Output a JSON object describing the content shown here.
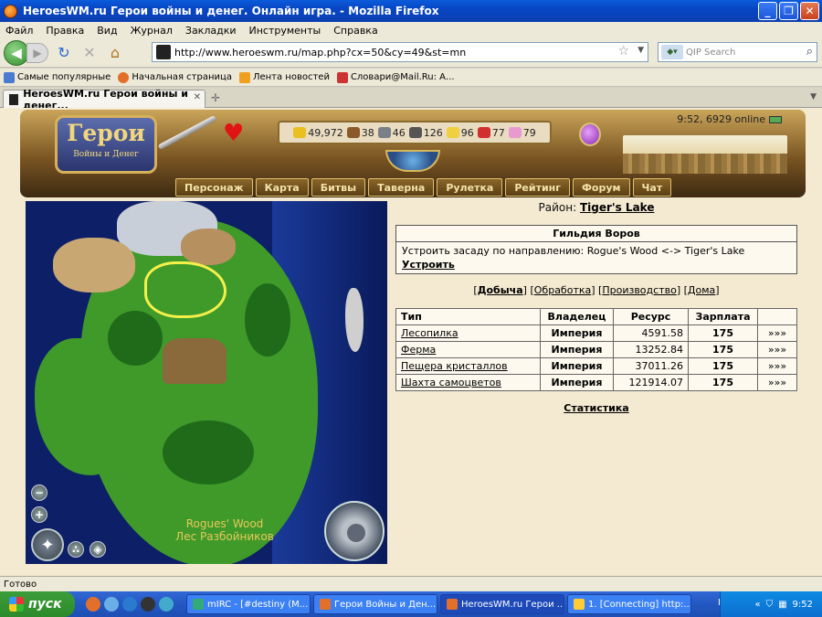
{
  "window": {
    "title": "HeroesWM.ru Герои войны и денег. Онлайн игра. - Mozilla Firefox"
  },
  "menu": [
    "Файл",
    "Правка",
    "Вид",
    "Журнал",
    "Закладки",
    "Инструменты",
    "Справка"
  ],
  "nav": {
    "url": "http://www.heroeswm.ru/map.php?cx=50&cy=49&st=mn",
    "search_placeholder": "QIP Search"
  },
  "bookmarks": [
    {
      "label": "Самые популярные",
      "color": "#4a7bd0"
    },
    {
      "label": "Начальная страница",
      "color": "#e2702a"
    },
    {
      "label": "Лента новостей",
      "color": "#f0a020"
    },
    {
      "label": "Словари@Mail.Ru: А...",
      "color": "#c33"
    }
  ],
  "tab": {
    "title": "HeroesWM.ru Герои войны и денег..."
  },
  "header": {
    "logo_big": "Герои",
    "logo_small": "Войны и Денег",
    "clock": "9:52, 6929 online",
    "resources": [
      {
        "icon": "gold-icon",
        "value": "49,972",
        "color": "#e8c020"
      },
      {
        "icon": "wood-icon",
        "value": "38",
        "color": "#8a5a2a"
      },
      {
        "icon": "ore-icon",
        "value": "46",
        "color": "#7a7f88"
      },
      {
        "icon": "mercury-icon",
        "value": "126",
        "color": "#555"
      },
      {
        "icon": "sulfur-icon",
        "value": "96",
        "color": "#f0d040"
      },
      {
        "icon": "crystal-icon",
        "value": "77",
        "color": "#d03030"
      },
      {
        "icon": "gems-icon",
        "value": "79",
        "color": "#e89ad0"
      }
    ],
    "nav": [
      "Персонаж",
      "Карта",
      "Битвы",
      "Таверна",
      "Рулетка",
      "Рейтинг",
      "Форум",
      "Чат"
    ]
  },
  "map": {
    "label_en": "Rogues' Wood",
    "label_ru": "Лес Разбойников"
  },
  "district": {
    "prefix": "Район:",
    "name": "Tiger's Lake"
  },
  "guild": {
    "title": "Гильдия Воров",
    "text": "Устроить засаду по направлению: Rogue's Wood <-> Tiger's Lake",
    "action": "Устроить"
  },
  "facility_tabs": [
    "Добыча",
    "Обработка",
    "Производство",
    "Дома"
  ],
  "table": {
    "headers": [
      "Тип",
      "Владелец",
      "Ресурс",
      "Зарплата",
      ""
    ],
    "rows": [
      {
        "name": "Лесопилка",
        "owner": "Империя",
        "resource": "4591.58",
        "salary": "175",
        "go": "»»»"
      },
      {
        "name": "Ферма",
        "owner": "Империя",
        "resource": "13252.84",
        "salary": "175",
        "go": "»»»"
      },
      {
        "name": "Пещера кристаллов",
        "owner": "Империя",
        "resource": "37011.26",
        "salary": "175",
        "go": "»»»"
      },
      {
        "name": "Шахта самоцветов",
        "owner": "Империя",
        "resource": "121914.07",
        "salary": "175",
        "go": "»»»"
      }
    ]
  },
  "stats_link": "Статистика",
  "status": "Готово",
  "taskbar": {
    "start": "пуск",
    "tasks": [
      {
        "label": "mIRC - [#destiny (M...",
        "color": "#3a7"
      },
      {
        "label": "Герои Войны и Ден...",
        "color": "#e2702a"
      },
      {
        "label": "HeroesWM.ru Герои ...",
        "color": "#e2702a"
      },
      {
        "label": "1. [Connecting] http:...",
        "color": "#fc3"
      }
    ],
    "lang": "RU",
    "time": "9:52"
  }
}
